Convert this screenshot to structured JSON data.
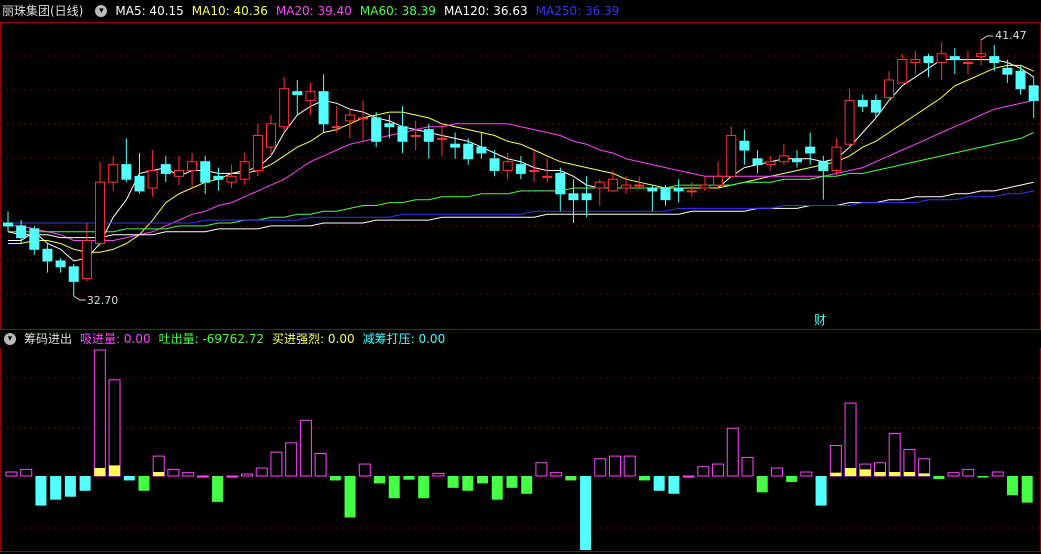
{
  "main_header": {
    "stock_title": "丽珠集团(日线)",
    "ma": [
      {
        "label": "MA5: 40.15",
        "color": "#ffffff"
      },
      {
        "label": "MA10: 40.36",
        "color": "#ffff55"
      },
      {
        "label": "MA20: 39.40",
        "color": "#ff44ff"
      },
      {
        "label": "MA60: 38.39",
        "color": "#44ff44"
      },
      {
        "label": "MA120: 36.63",
        "color": "#ffffff"
      },
      {
        "label": "MA250: 36.39",
        "color": "#3333ff"
      }
    ]
  },
  "annotations": {
    "high_label": "41.47",
    "low_label": "32.70",
    "fin_marker": "财"
  },
  "indicator_header": {
    "name": "筹码进出",
    "items": [
      {
        "label": "吸进量: 0.00",
        "color": "#ff44ff"
      },
      {
        "label": "吐出量: -69762.72",
        "color": "#44ff44"
      },
      {
        "label": "买进强烈: 0.00",
        "color": "#ffff55"
      },
      {
        "label": "减筹打压: 0.00",
        "color": "#44ffff"
      }
    ]
  },
  "colors": {
    "up": "#ff3333",
    "down": "#54ffff",
    "grid": "#7a0000",
    "border": "#9a0000"
  },
  "chart_data": {
    "type": "candlestick",
    "price_range": [
      32.7,
      41.47
    ],
    "candles": [
      [
        35.2,
        35.1,
        35.6,
        34.9
      ],
      [
        35.1,
        34.7,
        35.3,
        34.5
      ],
      [
        35.0,
        34.3,
        35.1,
        34.1
      ],
      [
        34.3,
        33.9,
        34.5,
        33.5
      ],
      [
        33.9,
        33.7,
        34.0,
        33.5
      ],
      [
        33.7,
        33.2,
        33.8,
        32.7
      ],
      [
        33.3,
        34.6,
        35.2,
        33.2
      ],
      [
        34.5,
        36.6,
        37.3,
        34.4
      ],
      [
        36.6,
        37.2,
        37.5,
        36.3
      ],
      [
        37.2,
        36.7,
        38.1,
        36.6
      ],
      [
        36.8,
        36.3,
        37.6,
        36.2
      ],
      [
        36.4,
        37.0,
        37.7,
        36.1
      ],
      [
        37.2,
        36.9,
        37.5,
        36.6
      ],
      [
        36.8,
        37.0,
        37.5,
        36.5
      ],
      [
        37.0,
        37.3,
        37.6,
        36.4
      ],
      [
        37.3,
        36.6,
        37.5,
        36.2
      ],
      [
        36.8,
        36.7,
        37.1,
        36.3
      ],
      [
        36.6,
        36.8,
        37.2,
        36.4
      ],
      [
        36.7,
        37.3,
        37.6,
        36.5
      ],
      [
        37.0,
        38.2,
        38.6,
        36.8
      ],
      [
        37.8,
        38.6,
        38.9,
        37.5
      ],
      [
        38.5,
        39.8,
        40.2,
        38.3
      ],
      [
        39.7,
        39.6,
        40.1,
        38.9
      ],
      [
        39.4,
        39.7,
        40.0,
        38.9
      ],
      [
        39.7,
        38.6,
        40.3,
        38.3
      ],
      [
        38.5,
        38.5,
        39.2,
        38.3
      ],
      [
        38.7,
        38.9,
        39.1,
        38.1
      ],
      [
        38.8,
        38.8,
        39.4,
        38.0
      ],
      [
        38.8,
        38.0,
        39.0,
        37.8
      ],
      [
        38.6,
        38.5,
        38.9,
        38.1
      ],
      [
        38.5,
        38.0,
        39.2,
        37.6
      ],
      [
        38.2,
        38.2,
        38.7,
        37.7
      ],
      [
        38.4,
        38.0,
        38.6,
        37.4
      ],
      [
        38.1,
        38.1,
        38.6,
        37.5
      ],
      [
        37.9,
        37.8,
        38.3,
        37.4
      ],
      [
        37.9,
        37.4,
        38.1,
        37.2
      ],
      [
        37.8,
        37.6,
        38.3,
        37.4
      ],
      [
        37.4,
        37.0,
        37.7,
        36.8
      ],
      [
        37.0,
        37.3,
        37.6,
        36.7
      ],
      [
        37.2,
        36.9,
        37.5,
        36.7
      ],
      [
        37.0,
        37.0,
        37.7,
        36.6
      ],
      [
        36.8,
        36.8,
        37.4,
        36.6
      ],
      [
        36.9,
        36.2,
        37.1,
        35.6
      ],
      [
        36.2,
        36.0,
        36.7,
        35.2
      ],
      [
        36.2,
        36.0,
        36.8,
        35.4
      ],
      [
        36.4,
        36.6,
        36.7,
        35.8
      ],
      [
        36.3,
        36.7,
        37.0,
        36.3
      ],
      [
        36.4,
        36.5,
        36.8,
        36.2
      ],
      [
        36.5,
        36.5,
        36.8,
        36.4
      ],
      [
        36.4,
        36.3,
        36.5,
        35.6
      ],
      [
        36.4,
        36.0,
        36.5,
        35.8
      ],
      [
        36.4,
        36.3,
        36.7,
        35.9
      ],
      [
        36.3,
        36.3,
        36.6,
        36.1
      ],
      [
        36.4,
        36.5,
        36.8,
        36.3
      ],
      [
        36.5,
        36.8,
        37.3,
        36.4
      ],
      [
        36.8,
        38.2,
        38.5,
        36.8
      ],
      [
        38.0,
        37.7,
        38.4,
        37.2
      ],
      [
        37.4,
        37.2,
        37.7,
        36.9
      ],
      [
        37.2,
        37.3,
        37.5,
        37.0
      ],
      [
        37.3,
        37.5,
        37.9,
        37.2
      ],
      [
        37.4,
        37.3,
        37.7,
        37.1
      ],
      [
        37.8,
        37.6,
        38.3,
        37.2
      ],
      [
        37.3,
        37.0,
        37.5,
        36.0
      ],
      [
        37.0,
        37.8,
        38.1,
        36.8
      ],
      [
        37.9,
        39.4,
        39.8,
        37.8
      ],
      [
        39.4,
        39.2,
        39.6,
        39.0
      ],
      [
        39.4,
        39.0,
        39.6,
        38.8
      ],
      [
        39.5,
        40.1,
        40.4,
        39.4
      ],
      [
        40.0,
        40.8,
        41.0,
        40.1
      ],
      [
        40.7,
        40.8,
        41.1,
        40.3
      ],
      [
        40.9,
        40.7,
        41.0,
        40.2
      ],
      [
        40.7,
        41.0,
        41.4,
        40.1
      ],
      [
        40.9,
        40.8,
        41.2,
        40.3
      ],
      [
        40.7,
        40.7,
        41.1,
        40.3
      ],
      [
        40.9,
        41.0,
        41.47,
        40.6
      ],
      [
        40.9,
        40.7,
        41.3,
        40.4
      ],
      [
        40.5,
        40.3,
        40.8,
        40.0
      ],
      [
        40.4,
        39.8,
        40.6,
        39.6
      ],
      [
        39.9,
        39.4,
        40.2,
        38.8
      ]
    ],
    "ma_lines": [
      {
        "name": "MA5",
        "color": "#ffffff",
        "start": 0,
        "values": [
          34.6,
          34.6,
          34.9,
          34.5,
          34.3,
          33.9,
          34.0,
          34.5,
          35.4,
          36.0,
          36.9,
          37.0,
          37.1,
          36.8,
          37.0,
          37.0,
          36.9,
          36.9,
          37.0,
          37.1,
          37.5,
          38.3,
          38.9,
          39.2,
          39.4,
          39.3,
          39.1,
          39.0,
          38.8,
          38.7,
          38.5,
          38.4,
          38.3,
          38.2,
          38.1,
          38.0,
          37.8,
          37.6,
          37.4,
          37.3,
          37.1,
          37.0,
          37.0,
          36.8,
          36.5,
          36.4,
          36.4,
          36.4,
          36.4,
          36.4,
          36.4,
          36.4,
          36.4,
          36.4,
          36.4,
          36.8,
          37.1,
          37.2,
          37.3,
          37.4,
          37.4,
          37.4,
          37.3,
          37.4,
          37.8,
          38.3,
          38.8,
          39.4,
          39.9,
          40.2,
          40.5,
          40.8,
          40.8,
          40.8,
          40.8,
          40.8,
          40.7,
          40.5,
          40.2
        ]
      },
      {
        "name": "MA10",
        "color": "#ffff55",
        "start": 0,
        "values": [
          34.5,
          34.5,
          34.6,
          34.6,
          34.5,
          34.3,
          34.2,
          34.2,
          34.3,
          34.5,
          34.8,
          35.3,
          35.9,
          36.2,
          36.4,
          36.6,
          36.7,
          36.9,
          36.9,
          37.0,
          37.2,
          37.5,
          37.8,
          38.0,
          38.3,
          38.4,
          38.6,
          38.8,
          38.9,
          39.0,
          39.0,
          38.9,
          38.8,
          38.6,
          38.5,
          38.4,
          38.3,
          38.2,
          38.0,
          37.9,
          37.7,
          37.5,
          37.3,
          37.2,
          37.1,
          37.0,
          36.9,
          36.7,
          36.6,
          36.5,
          36.4,
          36.4,
          36.4,
          36.4,
          36.4,
          36.5,
          36.6,
          36.7,
          36.8,
          36.9,
          37.0,
          37.1,
          37.2,
          37.3,
          37.5,
          37.8,
          38.0,
          38.3,
          38.6,
          38.9,
          39.2,
          39.5,
          39.9,
          40.1,
          40.3,
          40.5,
          40.6,
          40.6,
          40.4
        ]
      },
      {
        "name": "MA20",
        "color": "#ff44ff",
        "start": 0,
        "values": [
          35.1,
          35.1,
          35.0,
          34.9,
          34.8,
          34.6,
          34.6,
          34.6,
          34.6,
          34.7,
          34.8,
          34.9,
          35.1,
          35.3,
          35.5,
          35.6,
          35.8,
          35.9,
          36.1,
          36.3,
          36.5,
          36.7,
          37.0,
          37.3,
          37.5,
          37.7,
          37.9,
          38.0,
          38.1,
          38.2,
          38.3,
          38.4,
          38.5,
          38.5,
          38.6,
          38.6,
          38.6,
          38.6,
          38.6,
          38.5,
          38.4,
          38.3,
          38.2,
          38.0,
          37.9,
          37.7,
          37.6,
          37.4,
          37.3,
          37.2,
          37.1,
          37.0,
          36.9,
          36.8,
          36.8,
          36.8,
          36.8,
          36.8,
          36.8,
          36.8,
          36.8,
          36.8,
          36.8,
          36.9,
          37.0,
          37.1,
          37.3,
          37.5,
          37.7,
          37.9,
          38.1,
          38.3,
          38.5,
          38.7,
          38.9,
          39.1,
          39.2,
          39.3,
          39.4
        ]
      },
      {
        "name": "MA60",
        "color": "#44ff44",
        "start": 0,
        "values": [
          34.9,
          34.9,
          34.9,
          34.9,
          34.9,
          34.9,
          34.9,
          34.9,
          34.9,
          35.0,
          35.0,
          35.0,
          35.0,
          35.1,
          35.1,
          35.1,
          35.2,
          35.2,
          35.3,
          35.3,
          35.4,
          35.4,
          35.5,
          35.5,
          35.6,
          35.6,
          35.7,
          35.8,
          35.8,
          35.9,
          35.9,
          36.0,
          36.0,
          36.1,
          36.1,
          36.1,
          36.2,
          36.2,
          36.2,
          36.3,
          36.3,
          36.3,
          36.3,
          36.4,
          36.4,
          36.4,
          36.4,
          36.4,
          36.4,
          36.4,
          36.4,
          36.5,
          36.5,
          36.5,
          36.5,
          36.5,
          36.6,
          36.6,
          36.6,
          36.7,
          36.7,
          36.7,
          36.8,
          36.8,
          36.9,
          36.9,
          37.0,
          37.1,
          37.2,
          37.3,
          37.4,
          37.5,
          37.6,
          37.7,
          37.8,
          37.9,
          38.0,
          38.1,
          38.3
        ]
      },
      {
        "name": "MA120",
        "color": "#ffffff",
        "start": 0,
        "values": [
          34.9,
          34.8,
          34.8,
          34.8,
          34.7,
          34.7,
          34.7,
          34.7,
          34.8,
          34.8,
          34.8,
          34.8,
          34.9,
          34.9,
          34.9,
          34.9,
          35.0,
          35.0,
          35.0,
          35.0,
          35.1,
          35.1,
          35.1,
          35.1,
          35.2,
          35.2,
          35.2,
          35.2,
          35.3,
          35.3,
          35.3,
          35.3,
          35.3,
          35.4,
          35.4,
          35.4,
          35.4,
          35.4,
          35.4,
          35.4,
          35.4,
          35.5,
          35.5,
          35.5,
          35.5,
          35.5,
          35.5,
          35.5,
          35.5,
          35.5,
          35.5,
          35.5,
          35.6,
          35.6,
          35.6,
          35.6,
          35.6,
          35.7,
          35.7,
          35.7,
          35.7,
          35.8,
          35.8,
          35.8,
          35.9,
          35.9,
          35.9,
          36.0,
          36.0,
          36.1,
          36.1,
          36.1,
          36.2,
          36.2,
          36.3,
          36.3,
          36.4,
          36.5,
          36.6
        ]
      },
      {
        "name": "MA250",
        "color": "#3333ff",
        "start": 0,
        "values": [
          35.2,
          35.2,
          35.2,
          35.2,
          35.2,
          35.2,
          35.2,
          35.2,
          35.2,
          35.2,
          35.2,
          35.2,
          35.2,
          35.2,
          35.2,
          35.3,
          35.3,
          35.3,
          35.3,
          35.3,
          35.3,
          35.3,
          35.3,
          35.4,
          35.4,
          35.4,
          35.4,
          35.4,
          35.4,
          35.4,
          35.5,
          35.5,
          35.5,
          35.5,
          35.5,
          35.5,
          35.5,
          35.5,
          35.5,
          35.5,
          35.6,
          35.6,
          35.6,
          35.6,
          35.6,
          35.6,
          35.6,
          35.6,
          35.6,
          35.6,
          35.6,
          35.7,
          35.7,
          35.7,
          35.7,
          35.7,
          35.7,
          35.7,
          35.7,
          35.8,
          35.8,
          35.8,
          35.8,
          35.8,
          35.8,
          35.9,
          35.9,
          35.9,
          35.9,
          35.9,
          36.0,
          36.0,
          36.0,
          36.1,
          36.1,
          36.1,
          36.2,
          36.2,
          36.3
        ]
      }
    ],
    "indicator": {
      "range": [
        -1.0,
        1.9
      ],
      "bars": [
        {
          "v": 0.06,
          "y": 0
        },
        {
          "v": 0.1,
          "y": 0
        },
        {
          "v": -0.4,
          "y": 0
        },
        {
          "v": -0.32,
          "y": 0
        },
        {
          "v": -0.28,
          "y": 0
        },
        {
          "v": -0.2,
          "y": 0
        },
        {
          "v": 1.9,
          "y": 0.12
        },
        {
          "v": 1.45,
          "y": 0.16
        },
        {
          "v": -0.06,
          "y": 0
        },
        {
          "v": -0.2,
          "y": 0
        },
        {
          "v": 0.3,
          "y": 0.06
        },
        {
          "v": 0.1,
          "y": 0
        },
        {
          "v": 0.05,
          "y": 0
        },
        {
          "v": 0.0,
          "y": 0
        },
        {
          "v": -0.35,
          "y": 0
        },
        {
          "v": 0.0,
          "y": 0
        },
        {
          "v": 0.03,
          "y": 0
        },
        {
          "v": 0.12,
          "y": 0
        },
        {
          "v": 0.36,
          "y": 0
        },
        {
          "v": 0.5,
          "y": 0
        },
        {
          "v": 0.84,
          "y": 0
        },
        {
          "v": 0.34,
          "y": 0
        },
        {
          "v": -0.06,
          "y": 0
        },
        {
          "v": -0.56,
          "y": 0
        },
        {
          "v": 0.18,
          "y": 0
        },
        {
          "v": -0.1,
          "y": 0
        },
        {
          "v": -0.3,
          "y": 0
        },
        {
          "v": -0.05,
          "y": 0
        },
        {
          "v": -0.3,
          "y": 0
        },
        {
          "v": 0.04,
          "y": 0
        },
        {
          "v": -0.16,
          "y": 0
        },
        {
          "v": -0.2,
          "y": 0
        },
        {
          "v": -0.1,
          "y": 0
        },
        {
          "v": -0.32,
          "y": 0
        },
        {
          "v": -0.16,
          "y": 0
        },
        {
          "v": -0.24,
          "y": 0
        },
        {
          "v": 0.2,
          "y": 0
        },
        {
          "v": 0.05,
          "y": 0
        },
        {
          "v": -0.06,
          "y": 0
        },
        {
          "v": -1.0,
          "y": 0
        },
        {
          "v": 0.26,
          "y": 0
        },
        {
          "v": 0.3,
          "y": 0
        },
        {
          "v": 0.3,
          "y": 0
        },
        {
          "v": -0.06,
          "y": 0
        },
        {
          "v": -0.2,
          "y": 0
        },
        {
          "v": -0.24,
          "y": 0
        },
        {
          "v": 0.0,
          "y": 0
        },
        {
          "v": 0.14,
          "y": 0
        },
        {
          "v": 0.18,
          "y": 0
        },
        {
          "v": 0.72,
          "y": 0
        },
        {
          "v": 0.28,
          "y": 0
        },
        {
          "v": -0.22,
          "y": 0
        },
        {
          "v": 0.12,
          "y": 0
        },
        {
          "v": -0.08,
          "y": 0
        },
        {
          "v": 0.06,
          "y": 0
        },
        {
          "v": -0.4,
          "y": 0
        },
        {
          "v": 0.46,
          "y": 0.05
        },
        {
          "v": 1.1,
          "y": 0.12
        },
        {
          "v": 0.18,
          "y": 0.1
        },
        {
          "v": 0.2,
          "y": 0.06
        },
        {
          "v": 0.64,
          "y": 0.06
        },
        {
          "v": 0.4,
          "y": 0.06
        },
        {
          "v": 0.26,
          "y": 0.04
        },
        {
          "v": -0.04,
          "y": 0
        },
        {
          "v": 0.05,
          "y": 0
        },
        {
          "v": 0.1,
          "y": 0
        },
        {
          "v": -0.02,
          "y": 0
        },
        {
          "v": 0.06,
          "y": 0
        },
        {
          "v": -0.26,
          "y": 0
        },
        {
          "v": -0.36,
          "y": 0
        }
      ]
    }
  }
}
